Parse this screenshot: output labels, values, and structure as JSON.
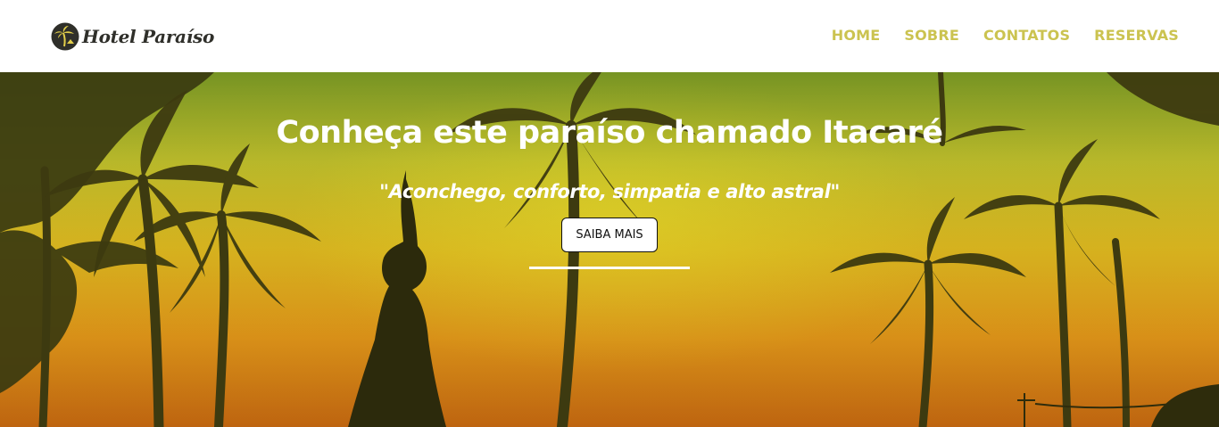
{
  "brand": {
    "name": "Hotel Paraíso",
    "logo_icon": "palm-tree-logo-icon"
  },
  "nav": {
    "items": [
      {
        "label": "HOME"
      },
      {
        "label": "SOBRE"
      },
      {
        "label": "CONTATOS"
      },
      {
        "label": "RESERVAS"
      }
    ],
    "color": "#cbc350"
  },
  "hero": {
    "title": "Conheça este paraíso chamado Itacaré",
    "tagline": "\"Aconchego, conforto, simpatia e alto astral\"",
    "button_label": "SAIBA MAIS"
  }
}
